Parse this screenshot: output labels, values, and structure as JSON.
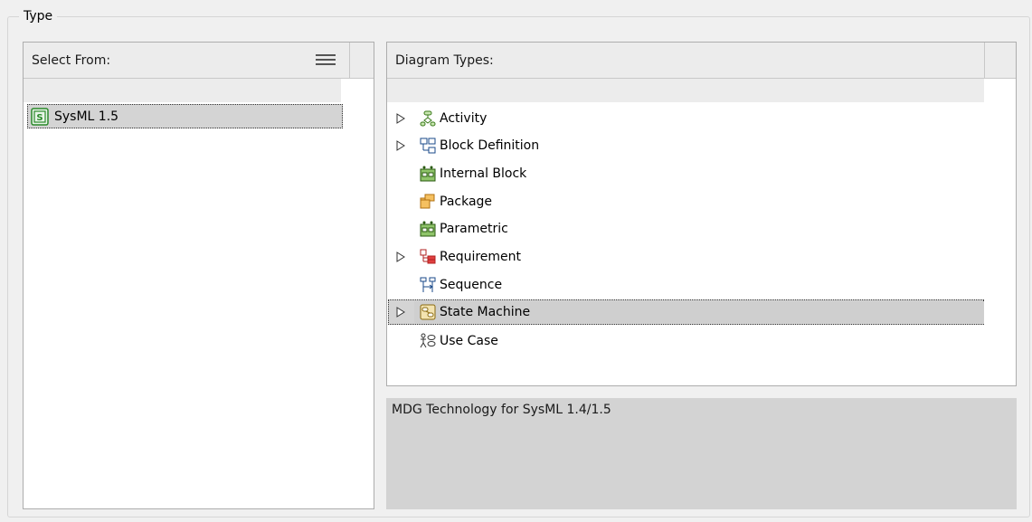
{
  "group": {
    "title": "Type"
  },
  "select_from": {
    "header": "Select From:",
    "items": [
      {
        "label": "SysML 1.5",
        "icon": "sysml-package-icon",
        "selected": true
      }
    ]
  },
  "diagram_types": {
    "header": "Diagram Types:",
    "items": [
      {
        "label": "Activity",
        "icon": "activity-diagram-icon",
        "expandable": true,
        "selected": false
      },
      {
        "label": "Block Definition",
        "icon": "block-definition-diagram-icon",
        "expandable": true,
        "selected": false
      },
      {
        "label": "Internal Block",
        "icon": "internal-block-diagram-icon",
        "expandable": false,
        "selected": false
      },
      {
        "label": "Package",
        "icon": "package-diagram-icon",
        "expandable": false,
        "selected": false
      },
      {
        "label": "Parametric",
        "icon": "parametric-diagram-icon",
        "expandable": false,
        "selected": false
      },
      {
        "label": "Requirement",
        "icon": "requirement-diagram-icon",
        "expandable": true,
        "selected": false
      },
      {
        "label": "Sequence",
        "icon": "sequence-diagram-icon",
        "expandable": false,
        "selected": false
      },
      {
        "label": "State Machine",
        "icon": "state-machine-diagram-icon",
        "expandable": true,
        "selected": true
      },
      {
        "label": "Use Case",
        "icon": "use-case-diagram-icon",
        "expandable": false,
        "selected": false
      }
    ]
  },
  "description": "MDG Technology for SysML 1.4/1.5"
}
